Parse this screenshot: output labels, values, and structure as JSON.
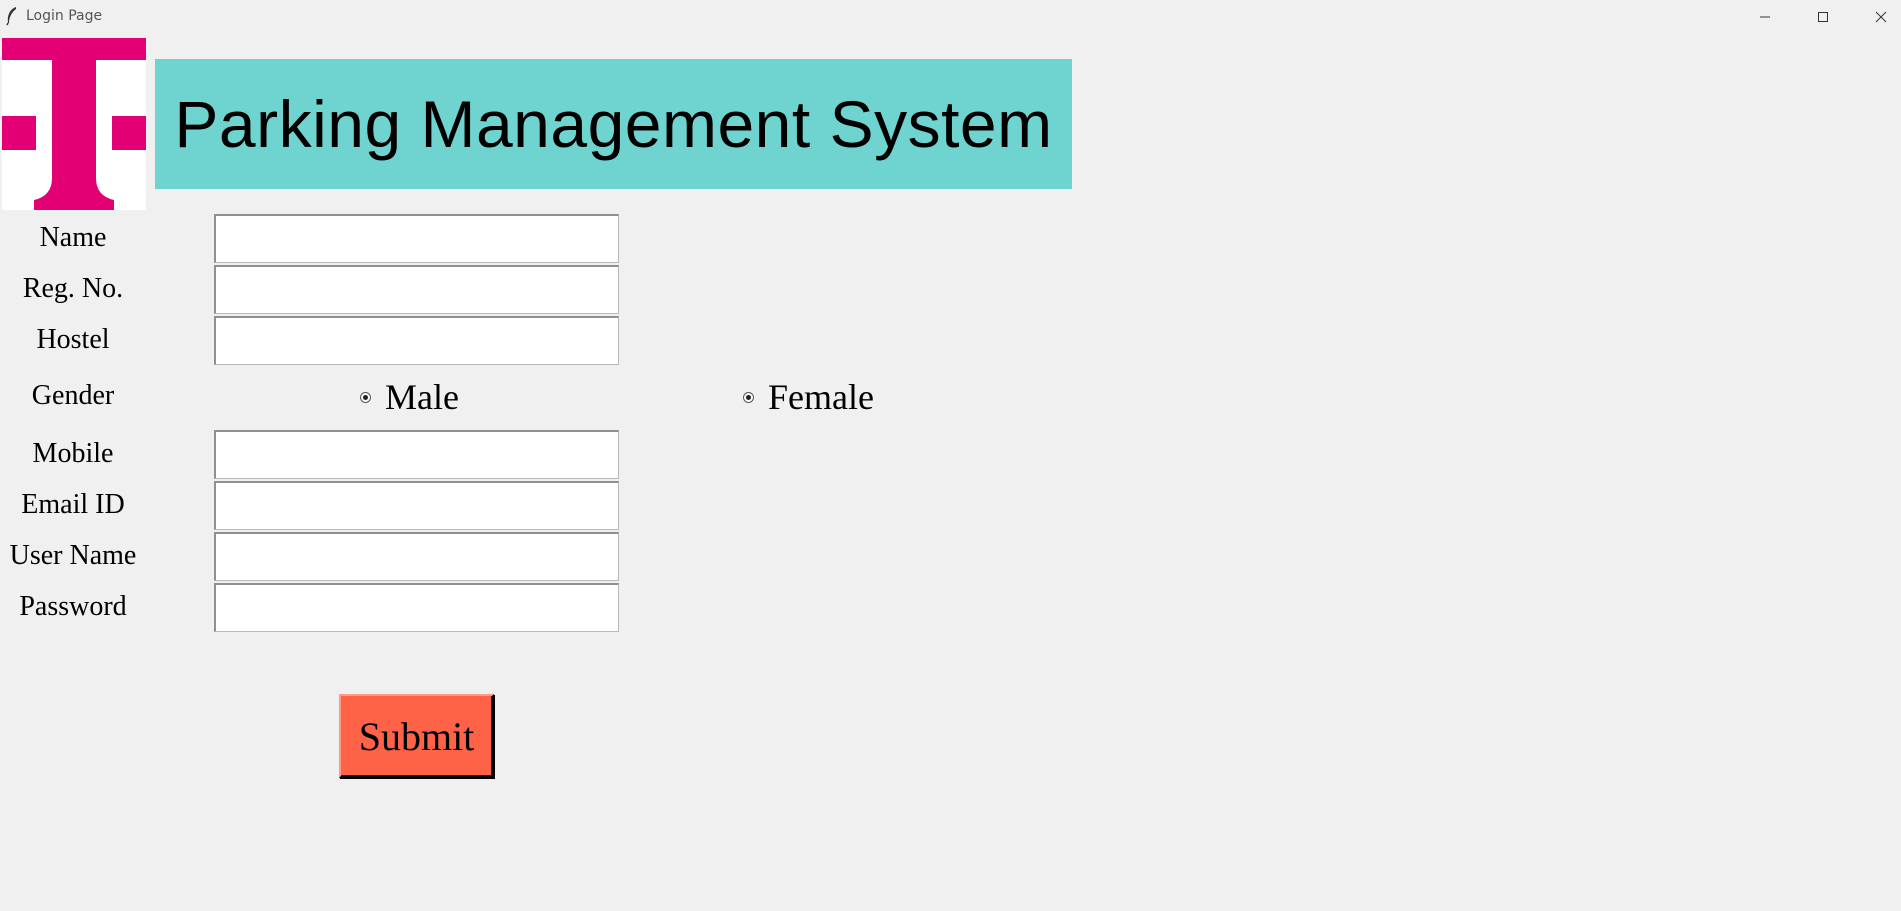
{
  "window": {
    "title": "Login Page",
    "controls": {
      "minimize_icon": "minimize-icon",
      "maximize_icon": "maximize-icon",
      "close_icon": "close-icon"
    }
  },
  "logo": {
    "icon": "telekom-t-logo",
    "color": "#e20074"
  },
  "header": {
    "title": "Parking Management System",
    "background": "#6fd3cf"
  },
  "form": {
    "fields": [
      {
        "label": "Name",
        "value": ""
      },
      {
        "label": "Reg. No.",
        "value": ""
      },
      {
        "label": "Hostel",
        "value": ""
      },
      {
        "label": "Mobile",
        "value": ""
      },
      {
        "label": "Email ID",
        "value": ""
      },
      {
        "label": "User Name",
        "value": ""
      },
      {
        "label": "Password",
        "value": ""
      }
    ],
    "gender": {
      "label": "Gender",
      "options": [
        "Male",
        "Female"
      ]
    },
    "submit_label": "Submit",
    "submit_color": "#ff6347"
  }
}
